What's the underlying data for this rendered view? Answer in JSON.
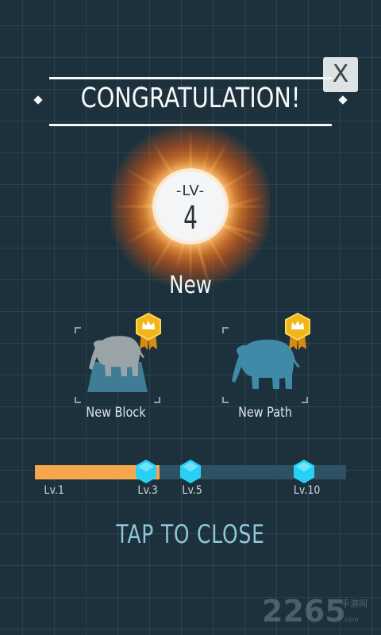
{
  "dialog": {
    "close_label": "X",
    "title": "CONGRATULATION!",
    "level_prefix": "-LV-",
    "level_number": "4",
    "section_label": "New"
  },
  "rewards": [
    {
      "label": "New Block",
      "icon": "elephant-icon",
      "color": "#9aa3a8",
      "base_color": "#3f7c96"
    },
    {
      "label": "New Path",
      "icon": "elephant-icon",
      "color": "#3f8aa6"
    }
  ],
  "progress": {
    "fill_fraction": 0.4,
    "milestones": [
      "Lv.1",
      "Lv.3",
      "Lv.5",
      "Lv.10"
    ],
    "fill_color": "#f6a64b",
    "track_color": "#2e5163",
    "gem_color": "#29d0f5"
  },
  "footer": {
    "tap_label": "TAP TO CLOSE"
  },
  "watermark": {
    "brand": "2265",
    "sub": "手游网",
    "url": ".com"
  }
}
